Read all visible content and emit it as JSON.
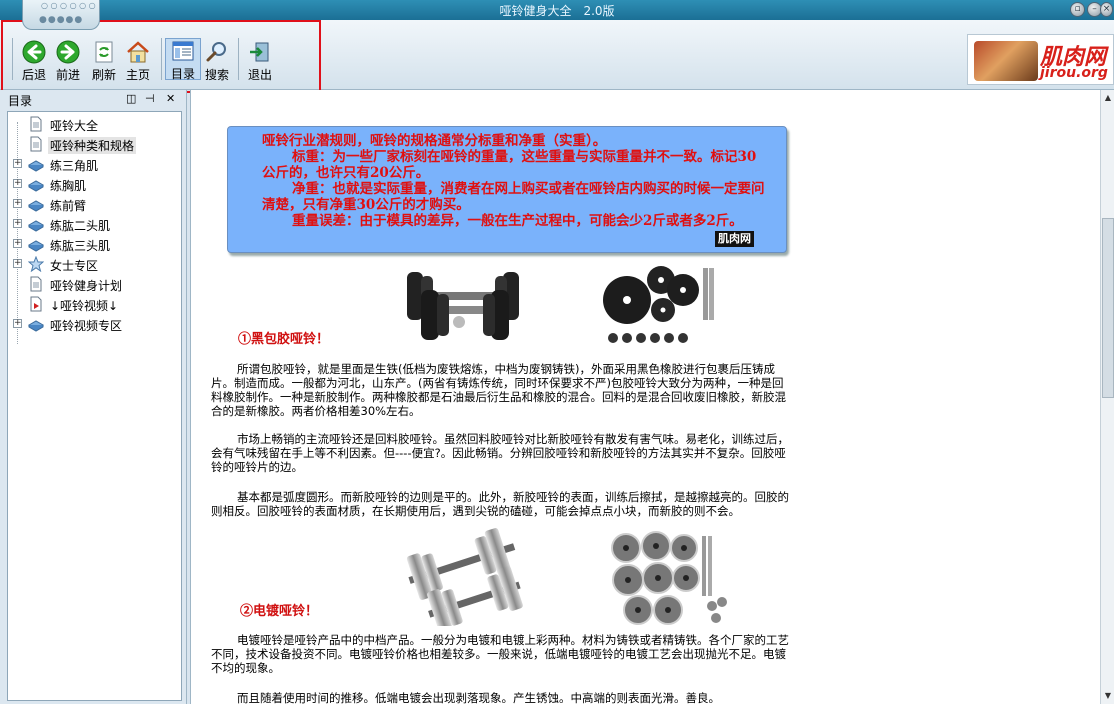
{
  "window": {
    "title": "哑铃健身大全　2.0版"
  },
  "toolbar": {
    "back": "后退",
    "forward": "前进",
    "refresh": "刷新",
    "home": "主页",
    "toc": "目录",
    "search": "搜索",
    "exit": "退出"
  },
  "logo": {
    "brand": "肌肉网",
    "url": "jirou.org"
  },
  "sidebar": {
    "title": "目录",
    "items": [
      {
        "label": "哑铃大全",
        "icon": "page-icon",
        "expandable": false
      },
      {
        "label": "哑铃种类和规格",
        "icon": "page-icon",
        "expandable": false,
        "selected": true
      },
      {
        "label": "练三角肌",
        "icon": "book-icon",
        "expandable": true
      },
      {
        "label": "练胸肌",
        "icon": "book-icon",
        "expandable": true
      },
      {
        "label": "练前臂",
        "icon": "book-icon",
        "expandable": true
      },
      {
        "label": "练肱二头肌",
        "icon": "book-icon",
        "expandable": true
      },
      {
        "label": "练肱三头肌",
        "icon": "book-icon",
        "expandable": true
      },
      {
        "label": "女士专区",
        "icon": "star-icon",
        "expandable": true
      },
      {
        "label": "哑铃健身计划",
        "icon": "page-icon",
        "expandable": false
      },
      {
        "label": "↓哑铃视频↓",
        "icon": "video-page-icon",
        "expandable": false
      },
      {
        "label": "哑铃视频专区",
        "icon": "book-icon",
        "expandable": true
      }
    ]
  },
  "content": {
    "notice": {
      "line1": "哑铃行业潜规则，哑铃的规格通常分标重和净重（实重）。",
      "line2": "标重：为一些厂家标刻在哑铃的重量，这些重量与实际重量并不一致。标记30公斤的，也许只有20公斤。",
      "line3": "净重：也就是实际重量，消费者在网上购买或者在哑铃店内购买的时候一定要问清楚，只有净重30公斤的才购买。",
      "line4": "重量误差：由于模具的差异，一般在生产过程中，可能会少2斤或者多2斤。",
      "tag": "肌肉网"
    },
    "section1_title": "①黑包胶哑铃！",
    "para1": "所谓包胶哑铃，就是里面是生铁(低档为废铁熔炼，中档为废钢铸铁)，外面采用黑色橡胶进行包裹后压铸成片。制造而成。一般都为河北，山东产。(两省有铸炼传统，同时环保要求不严)包胶哑铃大致分为两种，一种是回料橡胶制作。一种是新胶制作。两种橡胶都是石油最后衍生品和橡胶的混合。回料的是混合回收废旧橡胶，新胶混合的是新橡胶。两者价格相差30%左右。",
    "para2": "市场上畅销的主流哑铃还是回料胶哑铃。虽然回料胶哑铃对比新胶哑铃有散发有害气味。易老化，训练过后，会有气味残留在手上等不利因素。但----便宜?。因此畅销。分辨回胶哑铃和新胶哑铃的方法其实并不复杂。回胶哑铃的哑铃片的边。",
    "para3": "基本都是弧度圆形。而新胶哑铃的边则是平的。此外，新胶哑铃的表面，训练后擦拭，是越擦越亮的。回胶的则相反。回胶哑铃的表面材质，在长期使用后，遇到尖锐的磕碰，可能会掉点点小块，而新胶的则不会。",
    "section2_title": "②电镀哑铃！",
    "para4": "电镀哑铃是哑铃产品中的中档产品。一般分为电镀和电镀上彩两种。材料为铸铁或者精铸铁。各个厂家的工艺不同，技术设备投资不同。电镀哑铃价格也相差较多。一般来说，低端电镀哑铃的电镀工艺会出现抛光不足。电镀不均的现象。",
    "para5": "而且随着使用时间的推移。低端电镀会出现剥落现象。产生锈蚀。中高端的则表面光滑。善良。"
  },
  "colors": {
    "notice_bg": "#7ab2fb",
    "notice_text": "#e01010",
    "section_title": "#d01010",
    "highlight_box": "#e0101a"
  }
}
